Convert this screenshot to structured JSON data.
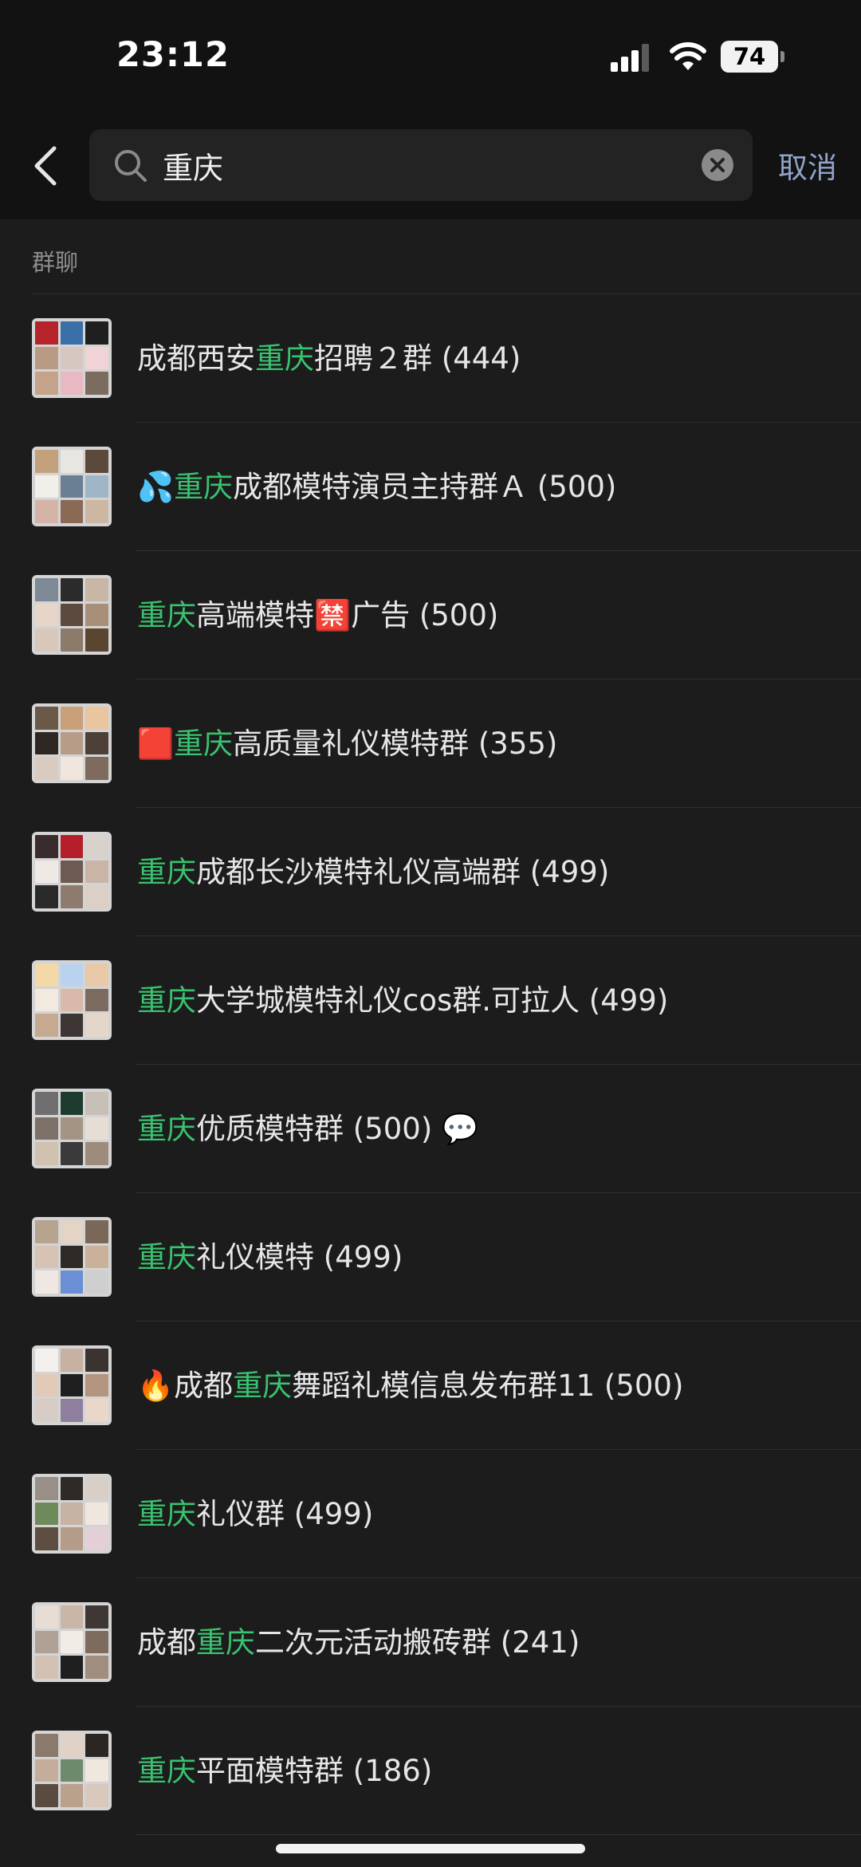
{
  "status_bar": {
    "time": "23:12",
    "battery": "74"
  },
  "search": {
    "query": "重庆",
    "cancel_label": "取消"
  },
  "section": {
    "title": "群聊"
  },
  "results": [
    {
      "prefix": "成都西安",
      "highlight": "重庆",
      "suffix": "招聘２群 (444)",
      "avatar": [
        "#b5242a",
        "#3b6fa8",
        "#1f1f1f",
        "#b99a84",
        "#d6c7c0",
        "#f0d3d6",
        "#c5a38a",
        "#e9b9c3",
        "#7c6b5f"
      ]
    },
    {
      "prefix": "💦",
      "highlight": "重庆",
      "suffix": "成都模特演员主持群Ａ (500)",
      "avatar": [
        "#c3a17d",
        "#e8e6e0",
        "#5b4a3a",
        "#f1efe9",
        "#6b7f94",
        "#9fb6c9",
        "#d4b4a6",
        "#8a6a55",
        "#cdb6a2"
      ]
    },
    {
      "prefix": "",
      "highlight": "重庆",
      "suffix": "高端模特🈲广告 (500)",
      "avatar": [
        "#7d8a95",
        "#2b2b2b",
        "#c9b7a6",
        "#e7d5c8",
        "#5d4a3f",
        "#a88f7a",
        "#d8c8bb",
        "#8c7a6b",
        "#5a4630"
      ]
    },
    {
      "prefix": "🟥",
      "highlight": "重庆",
      "suffix": "高质量礼仪模特群 (355)",
      "avatar": [
        "#6a5848",
        "#c9a07a",
        "#e9c6a0",
        "#2e2622",
        "#b79d88",
        "#4c4038",
        "#d9cbbf",
        "#f0e6de",
        "#7e6b5d"
      ]
    },
    {
      "prefix": "",
      "highlight": "重庆",
      "suffix": "成都长沙模特礼仪高端群 (499)",
      "avatar": [
        "#3a2c2c",
        "#b41f2b",
        "#d8d2cc",
        "#efe9e6",
        "#6d5a50",
        "#c9b4a6",
        "#2a2a2a",
        "#8e7b6d",
        "#dcd0c6"
      ]
    },
    {
      "prefix": "",
      "highlight": "重庆",
      "suffix": "大学城模特礼仪cos群.可拉人 (499)",
      "avatar": [
        "#f4d9a8",
        "#b9d3ef",
        "#e8c9a8",
        "#f2e9df",
        "#d9b9a9",
        "#7a6a60",
        "#c6a991",
        "#3d3533",
        "#e5d6ca"
      ]
    },
    {
      "prefix": "",
      "highlight": "重庆",
      "suffix": "优质模特群 (500) 💬",
      "avatar": [
        "#6f6f6f",
        "#1d3b2f",
        "#c8bfb6",
        "#7c7068",
        "#a39483",
        "#e6ddd5",
        "#d1c2b0",
        "#3a3a3a",
        "#9d8b7c"
      ]
    },
    {
      "prefix": "",
      "highlight": "重庆",
      "suffix": "礼仪模特 (499)",
      "avatar": [
        "#b8a38e",
        "#e3d4c6",
        "#7a6757",
        "#d6c3b3",
        "#2f2a26",
        "#c9b19c",
        "#efe8e2",
        "#6b8fd6",
        "#cfcfcf"
      ]
    },
    {
      "prefix": "🔥",
      "highlight": "成都",
      "suffix": "",
      "avatar": [
        "#f3f0ee",
        "#c7b1a2",
        "#3b3330",
        "#e2c9b8",
        "#1e1e1e",
        "#b3957f",
        "#d7cdc5",
        "#8e7f9e",
        "#e9d8ca"
      ]
    },
    {
      "prefix": "",
      "highlight": "重庆",
      "suffix": "礼仪群 (499)",
      "avatar": [
        "#9a8f86",
        "#2d2a28",
        "#d9cfc6",
        "#6f8a5a",
        "#c6b3a3",
        "#efe6de",
        "#5e4e42",
        "#b49c88",
        "#e5cfd6"
      ]
    },
    {
      "prefix": "成都",
      "highlight": "重庆",
      "suffix": "二次元活动搬砖群 (241)",
      "avatar": [
        "#e8ddd5",
        "#c9b6a6",
        "#3f3733",
        "#b0a196",
        "#f2ece6",
        "#7d6b5e",
        "#d3c2b3",
        "#1f1f1f",
        "#a08d7d"
      ]
    },
    {
      "prefix": "",
      "highlight": "重庆",
      "suffix": "平面模特群 (186)",
      "avatar": [
        "#8b7a6c",
        "#e0d2c6",
        "#2c2623",
        "#c4ae9b",
        "#6e8a6c",
        "#f0e7df",
        "#5a4b40",
        "#b9a18c",
        "#d8c9bc"
      ]
    }
  ],
  "row9_tail": {
    "before": "🔥成都",
    "highlight": "重庆",
    "after": "舞蹈礼模信息发布群11 (500)"
  }
}
